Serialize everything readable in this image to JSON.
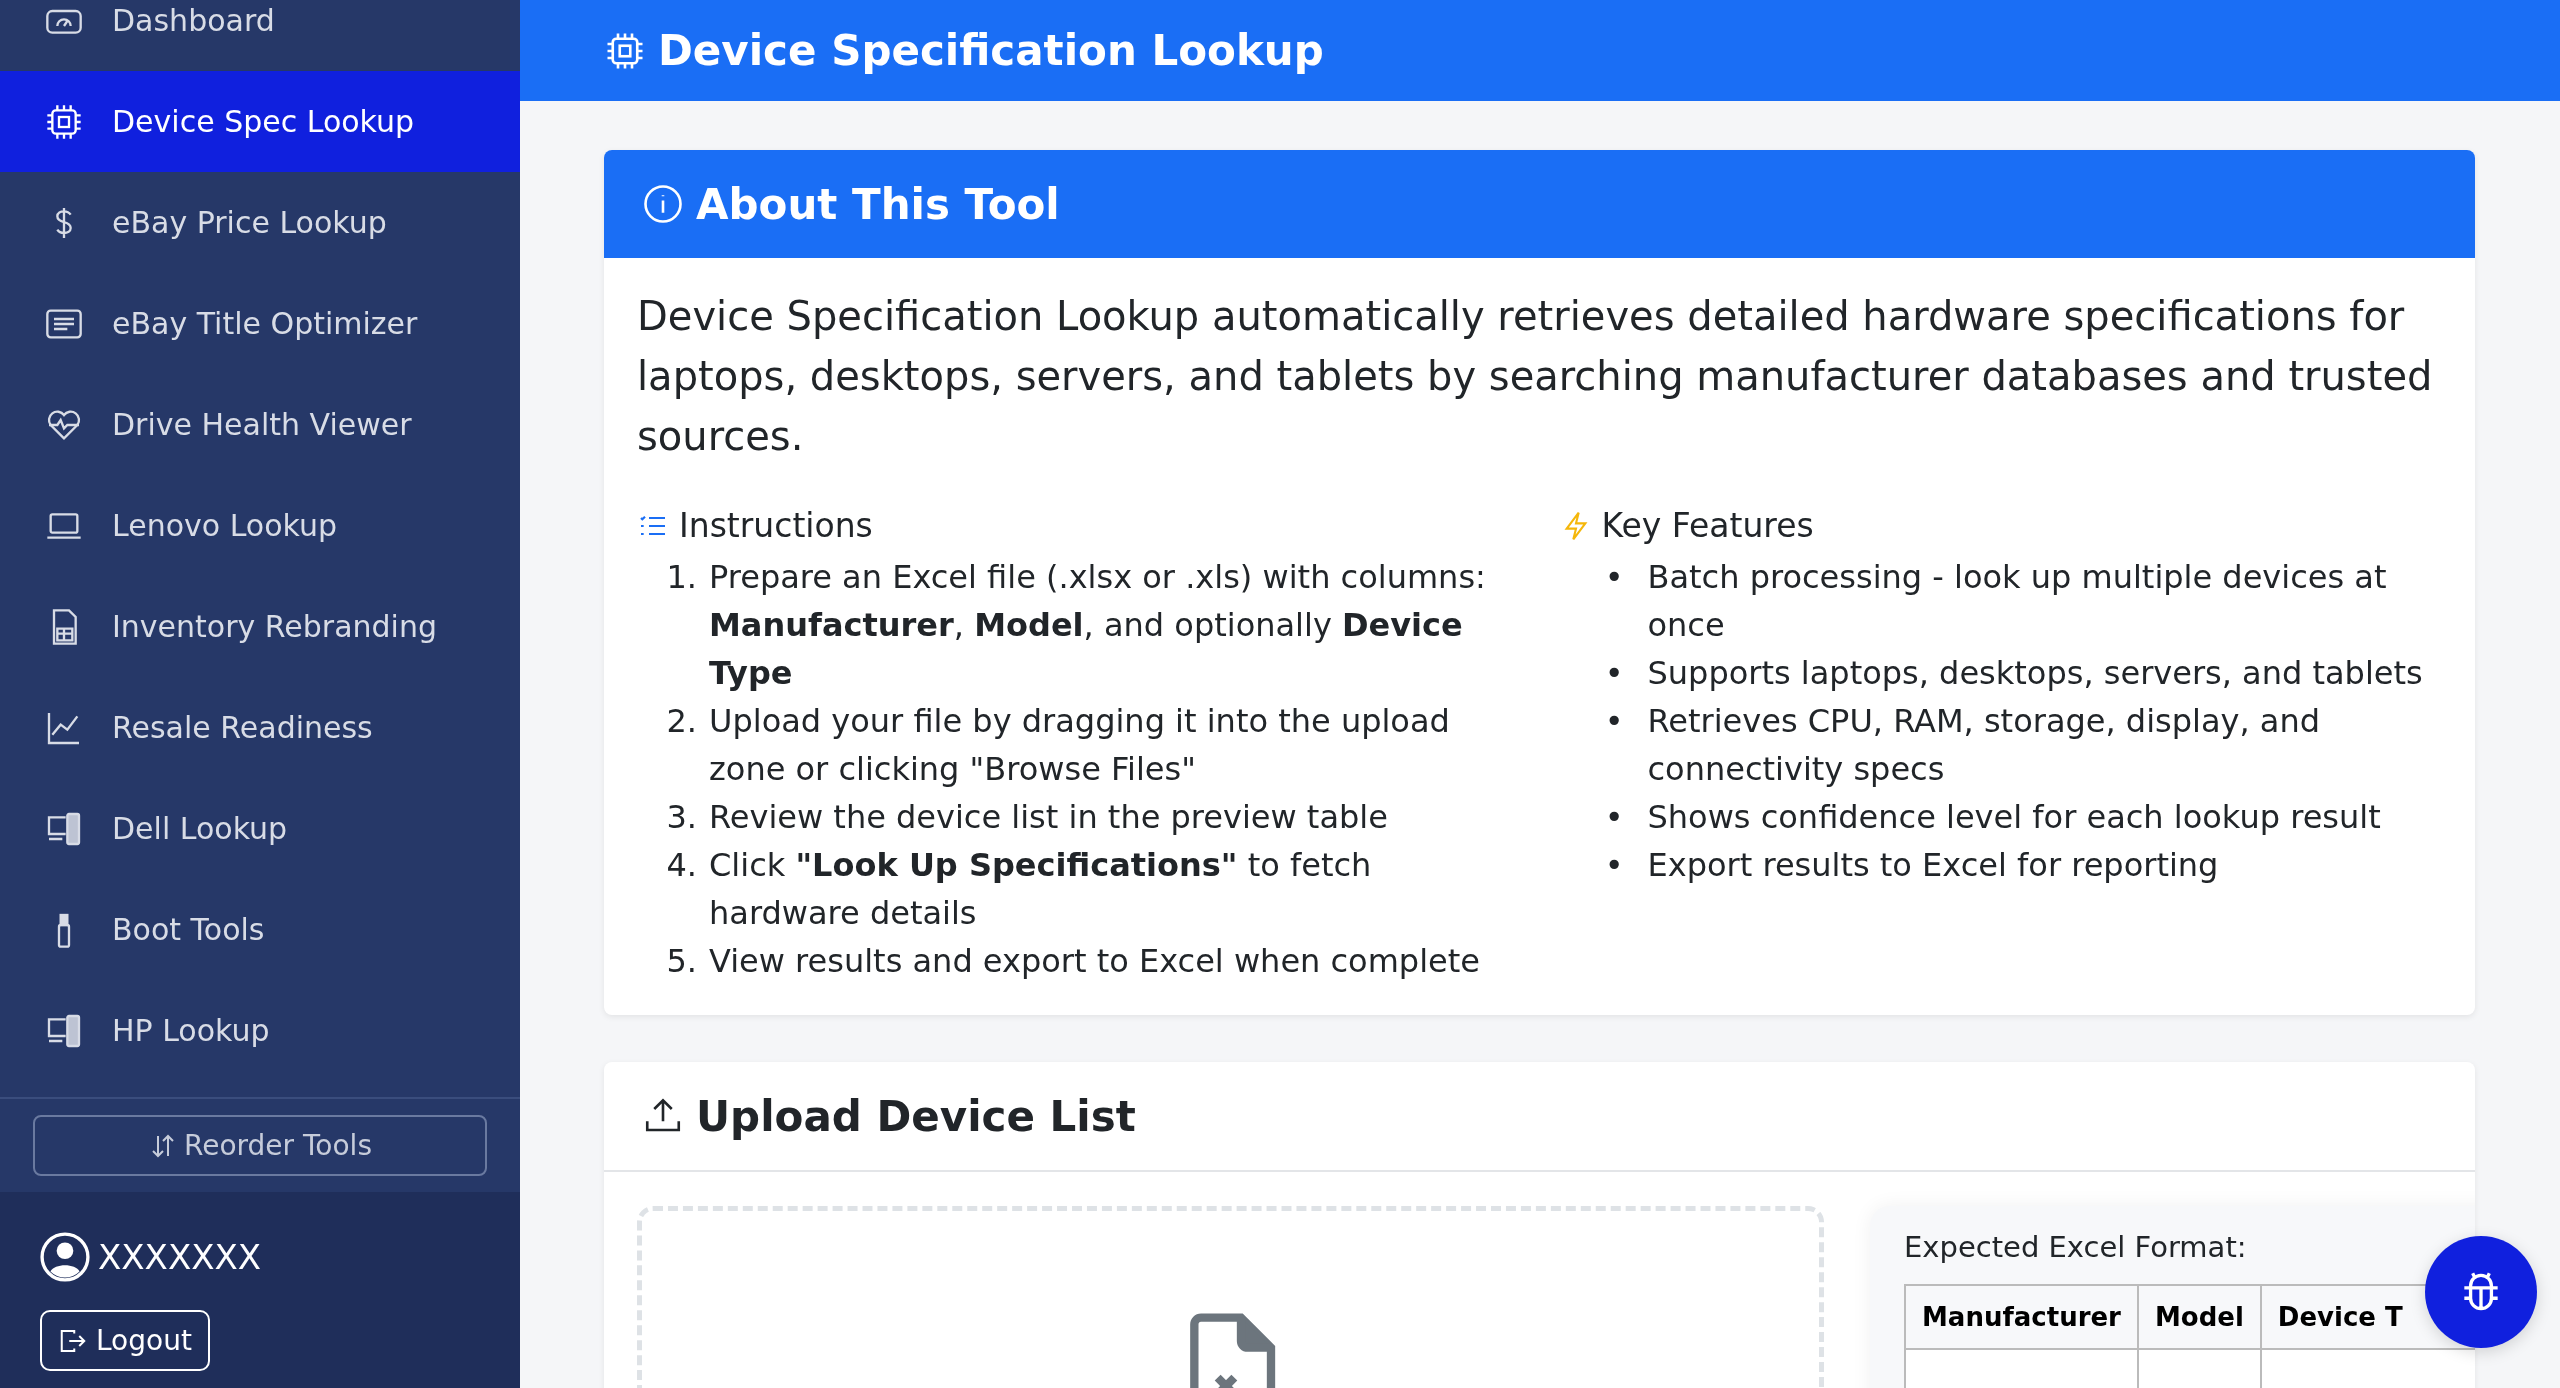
{
  "sidebar": {
    "items": [
      {
        "label": "Dashboard",
        "kind": "dashboard",
        "selected": false
      },
      {
        "label": "Device Spec Lookup",
        "kind": "chip",
        "selected": true
      },
      {
        "label": "eBay Price Lookup",
        "kind": "dollar",
        "selected": false
      },
      {
        "label": "eBay Title Optimizer",
        "kind": "document",
        "selected": false
      },
      {
        "label": "Drive Health Viewer",
        "kind": "heartbeat",
        "selected": false
      },
      {
        "label": "Lenovo Lookup",
        "kind": "laptop",
        "selected": false
      },
      {
        "label": "Inventory Rebranding",
        "kind": "spreadsheet",
        "selected": false
      },
      {
        "label": "Resale Readiness",
        "kind": "chart",
        "selected": false
      },
      {
        "label": "Dell Lookup",
        "kind": "devices",
        "selected": false
      },
      {
        "label": "Boot Tools",
        "kind": "usb",
        "selected": false
      },
      {
        "label": "HP Lookup",
        "kind": "devices",
        "selected": false
      }
    ],
    "reorder_button": "Reorder Tools",
    "user": {
      "name": "XXXXXXX"
    },
    "logout_button": "Logout"
  },
  "header": {
    "title": "Device Specification Lookup"
  },
  "about": {
    "title": "About This Tool",
    "description": "Device Specification Lookup automatically retrieves detailed hardware specifications for laptops, desktops, servers, and tablets by searching manufacturer databases and trusted sources.",
    "instructions": {
      "title": "Instructions",
      "steps": [
        {
          "number": "1.",
          "text": "Prepare an Excel file (.xlsx or .xls) with columns: **Manufacturer**, **Model**, and optionally **Device Type**"
        },
        {
          "number": "2.",
          "text": "Upload your file by dragging it into the upload zone or clicking \"Browse Files\""
        },
        {
          "number": "3.",
          "text": "Review the device list in the preview table"
        },
        {
          "number": "4.",
          "text": "Click **\"Look Up Specifications\"** to fetch hardware details"
        },
        {
          "number": "5.",
          "text": "View results and export to Excel when complete"
        }
      ]
    },
    "features": {
      "title": "Key Features",
      "items": [
        {
          "marker": "•",
          "text": "Batch processing - look up multiple devices at once"
        },
        {
          "marker": "•",
          "text": "Supports laptops, desktops, servers, and tablets"
        },
        {
          "marker": "•",
          "text": "Retrieves CPU, RAM, storage, display, and connectivity specs"
        },
        {
          "marker": "•",
          "text": "Shows confidence level for each lookup result"
        },
        {
          "marker": "•",
          "text": "Export results to Excel for reporting"
        }
      ]
    }
  },
  "upload": {
    "title": "Upload Device List",
    "format": {
      "title": "Expected Excel Format:",
      "columns": [
        "Manufacturer",
        "Model",
        "Device T"
      ]
    }
  }
}
